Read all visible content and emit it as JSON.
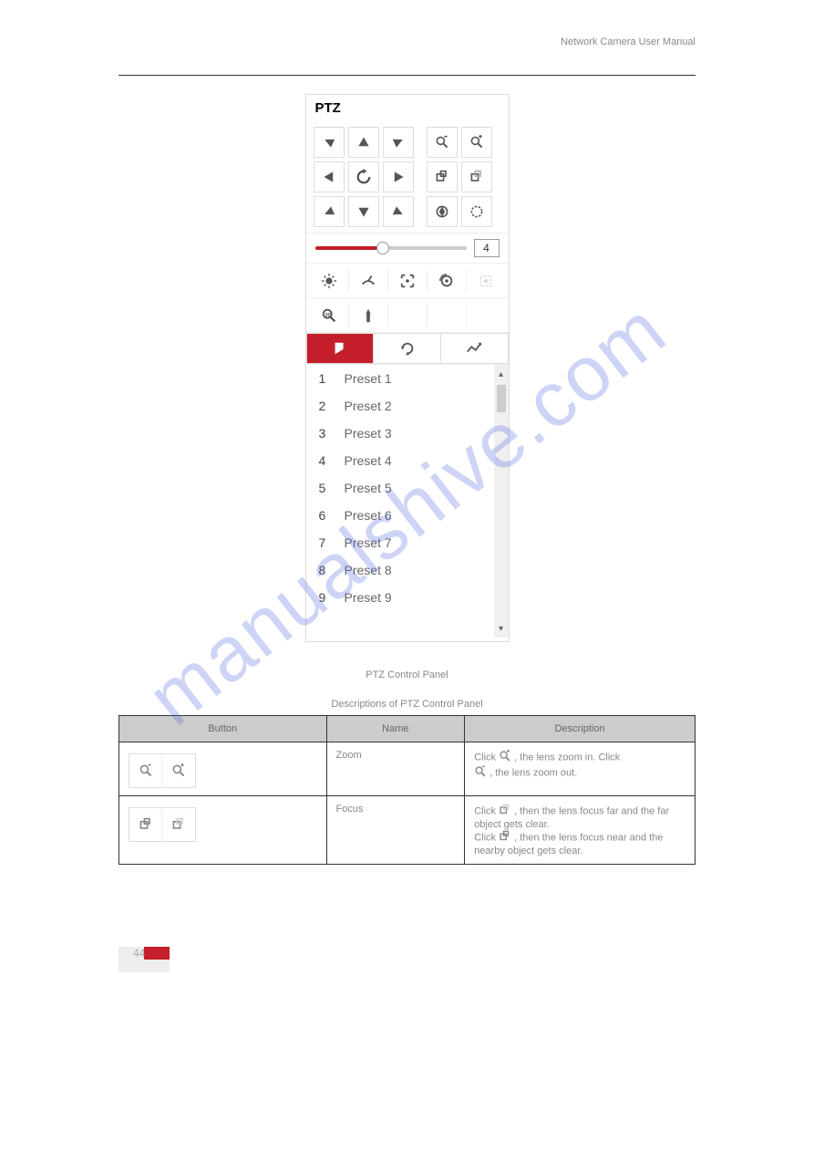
{
  "header": "Network Camera User Manual",
  "watermark": "manualshive.com",
  "panel": {
    "title": "PTZ",
    "speed_value": "4",
    "presets": [
      {
        "n": "1",
        "name": "Preset 1"
      },
      {
        "n": "2",
        "name": "Preset 2"
      },
      {
        "n": "3",
        "name": "Preset 3"
      },
      {
        "n": "4",
        "name": "Preset 4"
      },
      {
        "n": "5",
        "name": "Preset 5"
      },
      {
        "n": "6",
        "name": "Preset 6"
      },
      {
        "n": "7",
        "name": "Preset 7"
      },
      {
        "n": "8",
        "name": "Preset 8"
      },
      {
        "n": "9",
        "name": "Preset 9"
      }
    ]
  },
  "figure_caption": "PTZ Control Panel",
  "table_caption": "Descriptions of PTZ Control Panel",
  "table": {
    "headers": [
      "Button",
      "Name",
      "Description"
    ],
    "rows": [
      {
        "name": "Zoom",
        "icon_a": "zoom-out",
        "icon_b": "zoom-in",
        "desc_prefix_a": "Click ",
        "desc_mid_a": ", the lens zoom in. Click ",
        "desc_suffix_a": ", the lens zoom out."
      },
      {
        "name": "Focus",
        "icon_a": "focus-near",
        "icon_b": "focus-far",
        "desc_1": "Click ",
        "desc_2": ", then the lens focus far and the far object gets clear.",
        "desc_3": "Click ",
        "desc_4": ", then the lens focus near and the nearby object gets clear."
      }
    ]
  },
  "page_number": "44"
}
